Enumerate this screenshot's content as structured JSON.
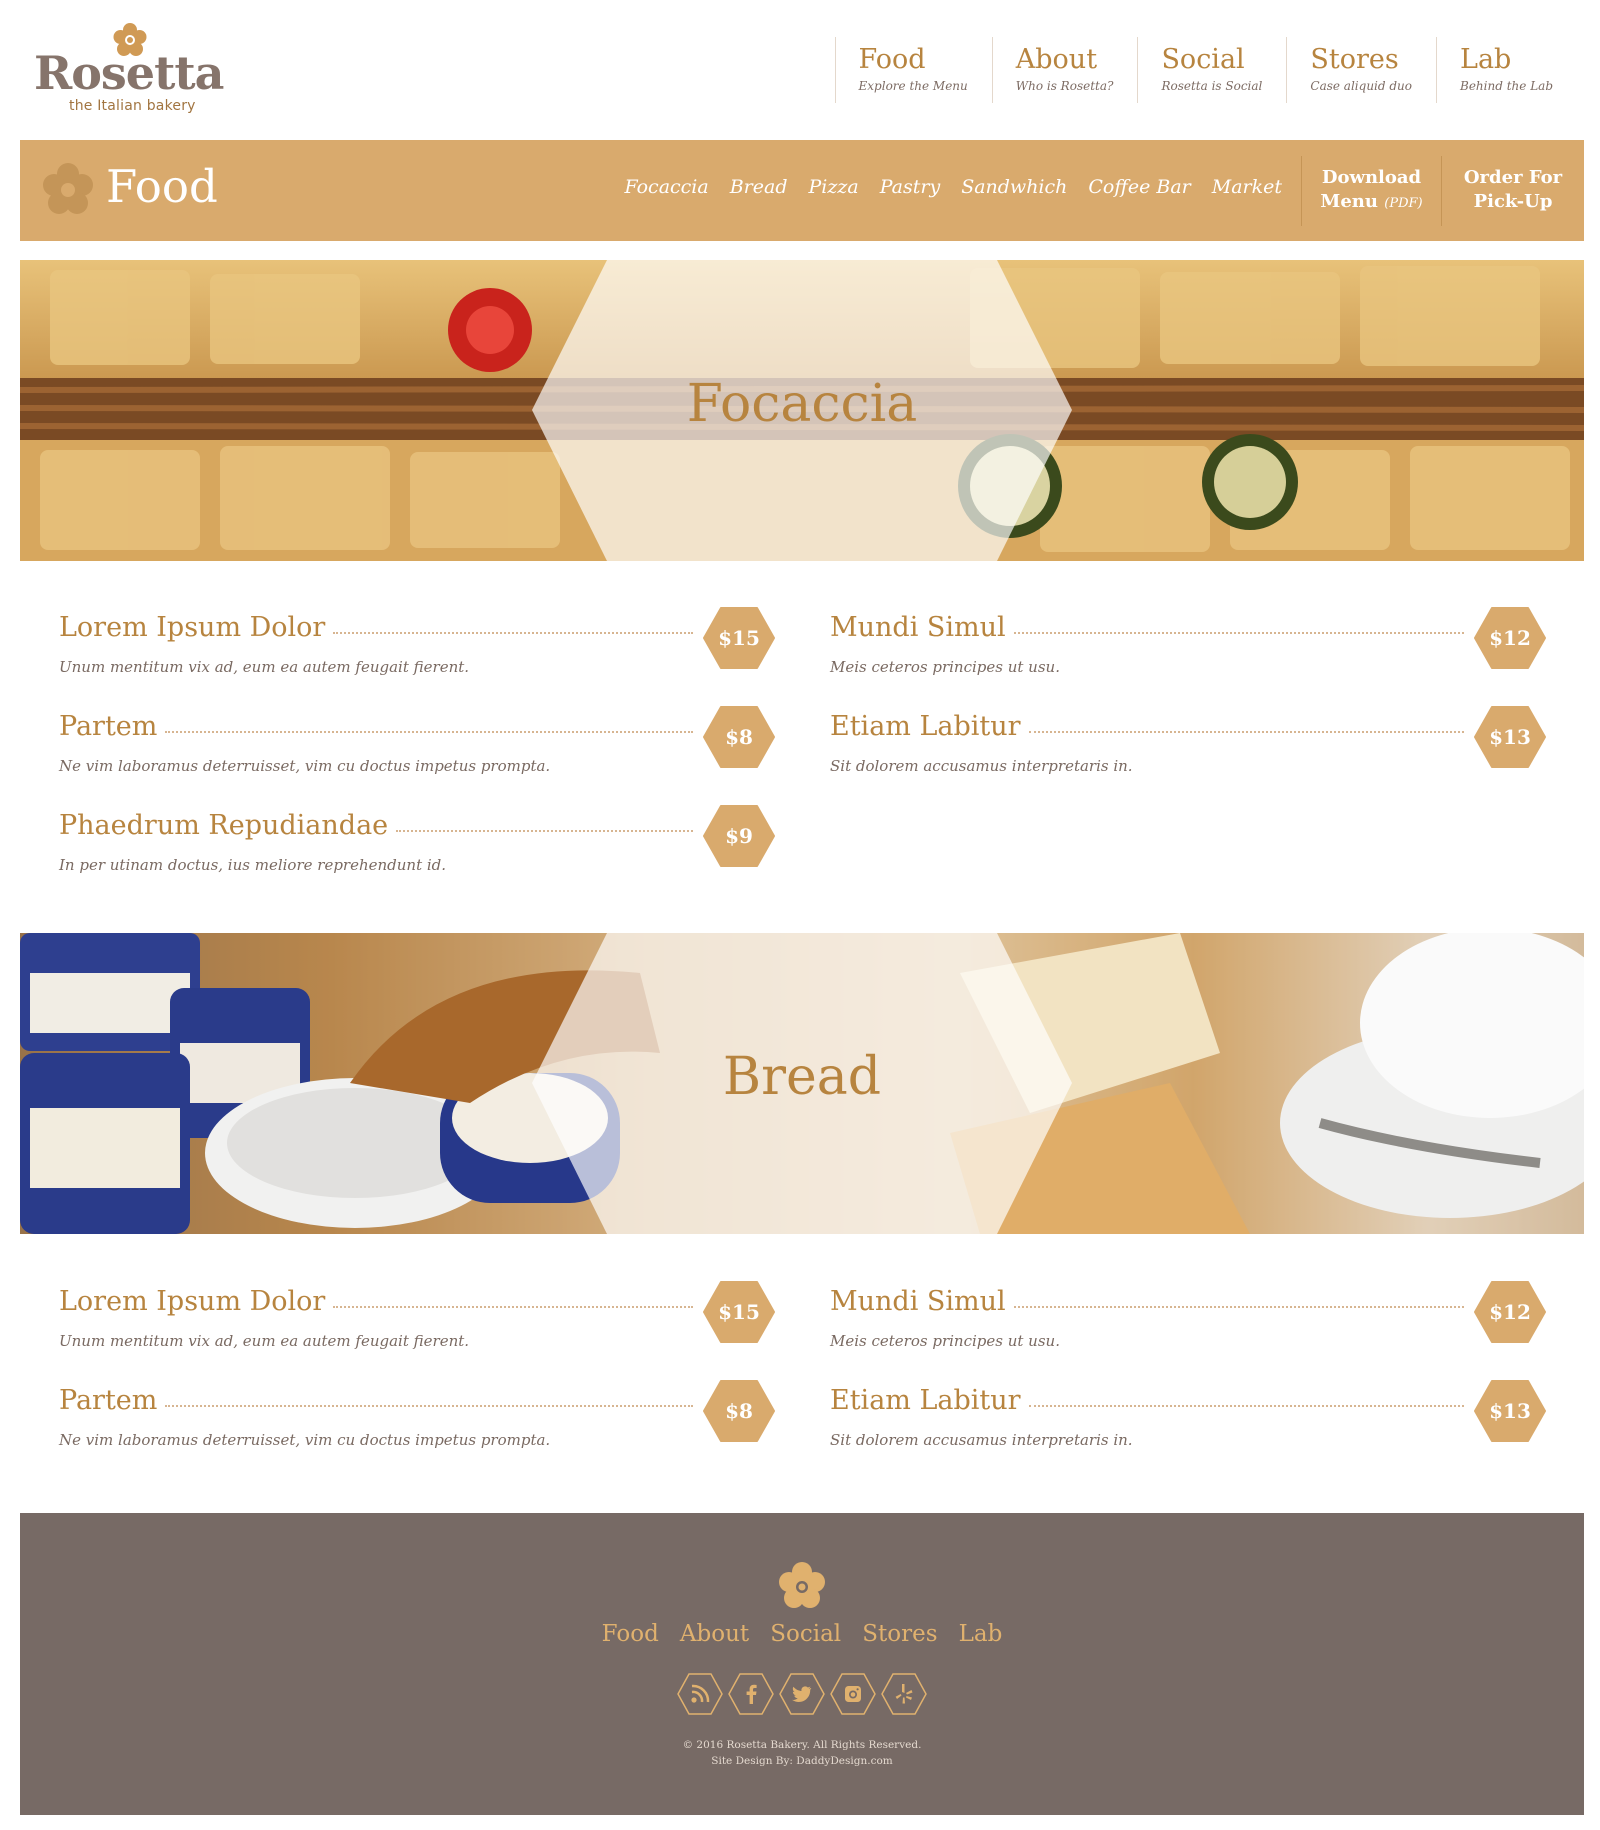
{
  "brand": {
    "name": "Rosetta",
    "tagline": "the Italian bakery"
  },
  "topnav": [
    {
      "title": "Food",
      "sub": "Explore the Menu"
    },
    {
      "title": "About",
      "sub": "Who is Rosetta?"
    },
    {
      "title": "Social",
      "sub": "Rosetta is Social"
    },
    {
      "title": "Stores",
      "sub": "Case aliquid duo"
    },
    {
      "title": "Lab",
      "sub": "Behind the Lab"
    }
  ],
  "foodbar": {
    "title": "Food",
    "subnav": [
      "Focaccia",
      "Bread",
      "Pizza",
      "Pastry",
      "Sandwhich",
      "Coffee Bar",
      "Market"
    ],
    "download_line1": "Download",
    "download_line2": "Menu",
    "download_small": "(PDF)",
    "order_line1": "Order For",
    "order_line2": "Pick-Up"
  },
  "sections": [
    {
      "title": "Focaccia",
      "left": [
        {
          "name": "Lorem Ipsum Dolor",
          "desc": "Unum mentitum vix ad, eum ea autem feugait fierent.",
          "price": "$15"
        },
        {
          "name": "Partem",
          "desc": "Ne vim laboramus deterruisset, vim cu doctus impetus prompta.",
          "price": "$8"
        },
        {
          "name": "Phaedrum Repudiandae",
          "desc": "In per utinam doctus, ius meliore reprehendunt id.",
          "price": "$9"
        }
      ],
      "right": [
        {
          "name": "Mundi Simul",
          "desc": "Meis ceteros principes ut usu.",
          "price": "$12"
        },
        {
          "name": "Etiam Labitur",
          "desc": "Sit dolorem accusamus interpretaris in.",
          "price": "$13"
        }
      ]
    },
    {
      "title": "Bread",
      "left": [
        {
          "name": "Lorem Ipsum Dolor",
          "desc": "Unum mentitum vix ad, eum ea autem feugait fierent.",
          "price": "$15"
        },
        {
          "name": "Partem",
          "desc": "Ne vim laboramus deterruisset, vim cu doctus impetus prompta.",
          "price": "$8"
        }
      ],
      "right": [
        {
          "name": "Mundi Simul",
          "desc": "Meis ceteros principes ut usu.",
          "price": "$12"
        },
        {
          "name": "Etiam Labitur",
          "desc": "Sit dolorem accusamus interpretaris in.",
          "price": "$13"
        }
      ]
    }
  ],
  "footer": {
    "links": [
      "Food",
      "About",
      "Social",
      "Stores",
      "Lab"
    ],
    "social_icons": [
      "rss-icon",
      "facebook-icon",
      "twitter-icon",
      "instagram-icon",
      "yelp-icon"
    ],
    "copyright": "© 2016 Rosetta Bakery. All Rights Reserved.",
    "credit": "Site Design By: DaddyDesign.com"
  },
  "colors": {
    "accent": "#d9aa6d",
    "title": "#b7843f",
    "footer_bg": "#776a65",
    "text": "#7a6a62"
  }
}
